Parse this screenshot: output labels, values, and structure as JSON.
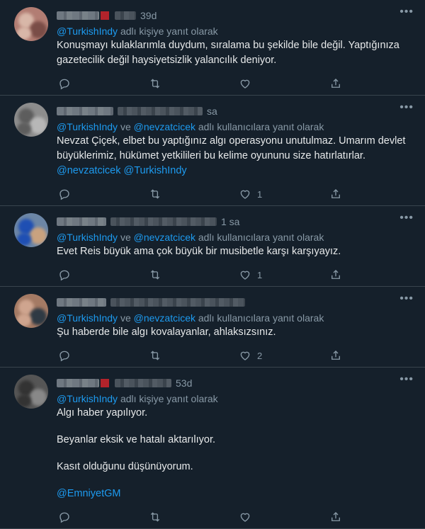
{
  "tweets": [
    {
      "time": "39d",
      "reply_to": [
        "@TurkishIndy"
      ],
      "reply_joiner": "",
      "reply_suffix": "adlı kişiye yanıt olarak",
      "text_lines": [
        "Konuşmayı kulaklarımla duydum, sıralama bu şekilde bile değil. Yaptığınıza gazetecilik değil haysiyetsizlik yalancılık deniyor."
      ],
      "mentions_line": "",
      "likes": "",
      "retweets": "",
      "replies": ""
    },
    {
      "time": "sa",
      "reply_to": [
        "@TurkishIndy",
        "@nevzatcicek"
      ],
      "reply_joiner": "ve",
      "reply_suffix": "adlı kullanıcılara yanıt olarak",
      "text_lines": [
        "Nevzat Çiçek, elbet bu yaptığınız algı operasyonu unutulmaz. Umarım devlet büyüklerimiz, hükümet yetkilileri bu kelime oyununu size hatırlatırlar."
      ],
      "mentions_line": "@nevzatcicek @TurkishIndy",
      "likes": "1",
      "retweets": "",
      "replies": ""
    },
    {
      "time": "1 sa",
      "reply_to": [
        "@TurkishIndy",
        "@nevzatcicek"
      ],
      "reply_joiner": "ve",
      "reply_suffix": "adlı kullanıcılara yanıt olarak",
      "text_lines": [
        "Evet Reis büyük ama çok büyük bir musibetle karşı karşıyayız."
      ],
      "mentions_line": "",
      "likes": "1",
      "retweets": "",
      "replies": ""
    },
    {
      "time": "",
      "reply_to": [
        "@TurkishIndy",
        "@nevzatcicek"
      ],
      "reply_joiner": "ve",
      "reply_suffix": "adlı kullanıcılara yanıt olarak",
      "text_lines": [
        "Şu haberde bile algı kovalayanlar, ahlaksızsınız."
      ],
      "mentions_line": "",
      "likes": "2",
      "retweets": "",
      "replies": ""
    },
    {
      "time": "53d",
      "reply_to": [
        "@TurkishIndy"
      ],
      "reply_joiner": "",
      "reply_suffix": "adlı kişiye yanıt olarak",
      "text_lines": [
        "Algı haber yapılıyor.",
        "Beyanlar eksik ve hatalı aktarılıyor.",
        "Kasıt olduğunu düşünüyorum."
      ],
      "mentions_line": "@EmniyetGM",
      "likes": "",
      "retweets": "",
      "replies": ""
    }
  ],
  "more_label": "•••",
  "colors": {
    "background": "#15202b",
    "accent": "#1d9bf0",
    "muted": "#8899a6",
    "divider": "#38444d"
  }
}
